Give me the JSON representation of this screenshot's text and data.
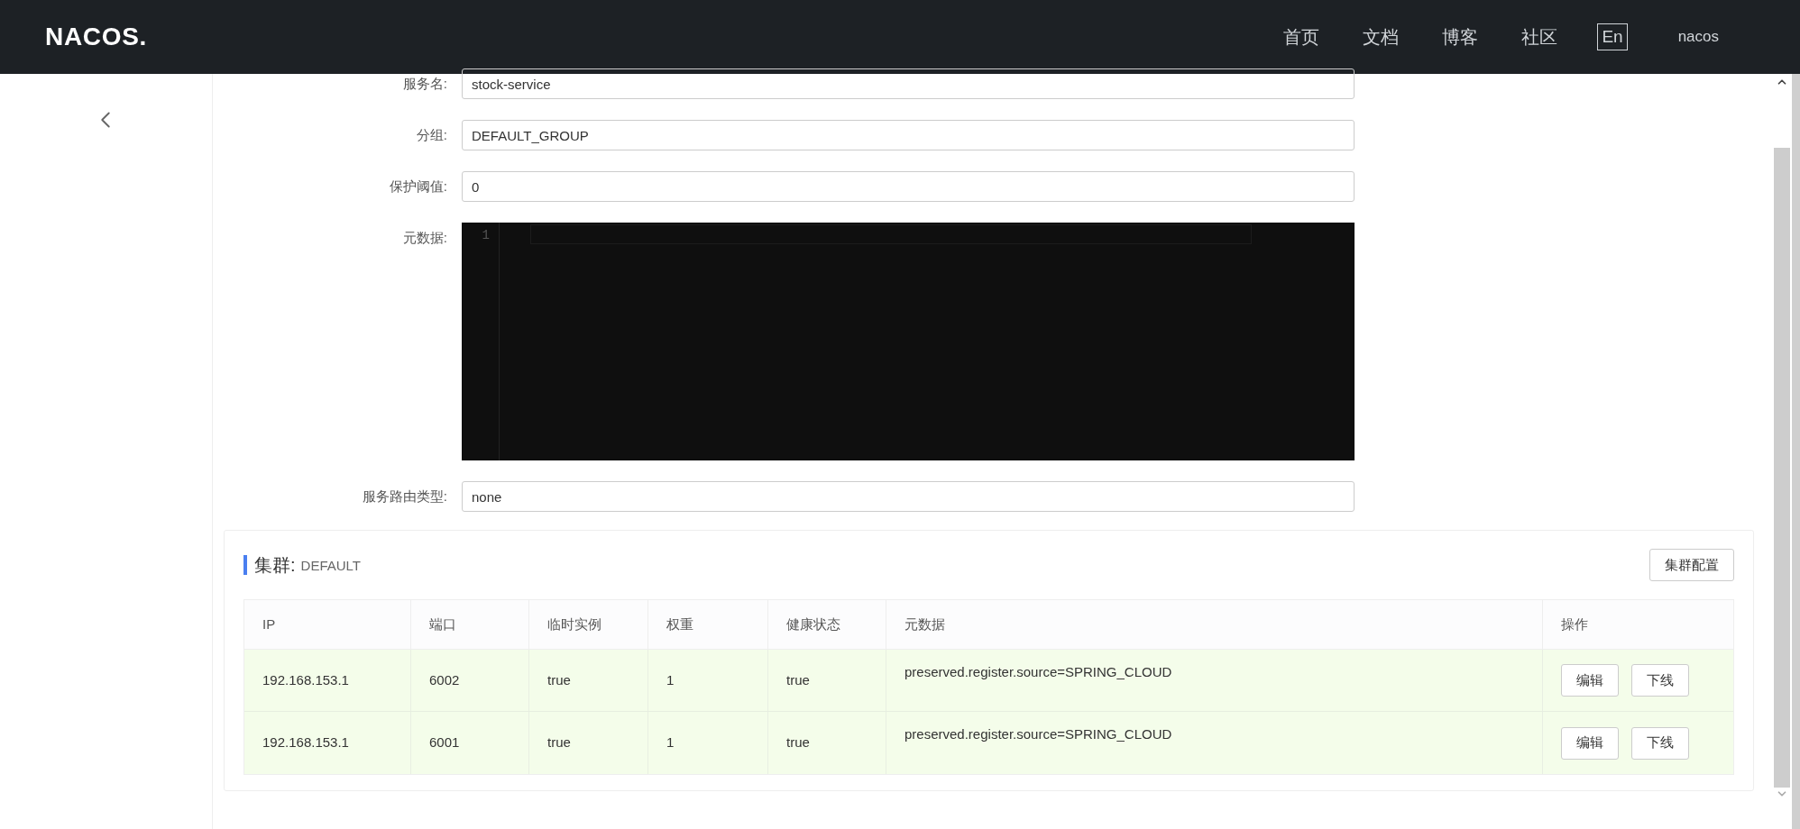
{
  "header": {
    "logo": "NACOS.",
    "nav": [
      "首页",
      "文档",
      "博客",
      "社区"
    ],
    "language": "En",
    "user": "nacos"
  },
  "form": {
    "fields": [
      {
        "kind": "input",
        "label": "服务名:",
        "value": "stock-service"
      },
      {
        "kind": "input",
        "label": "分组:",
        "value": "DEFAULT_GROUP"
      },
      {
        "kind": "input",
        "label": "保护阈值:",
        "value": "0"
      },
      {
        "kind": "editor",
        "label": "元数据:",
        "line_numbers": [
          "1"
        ]
      },
      {
        "kind": "input",
        "label": "服务路由类型:",
        "value": "none"
      }
    ]
  },
  "cluster": {
    "title": "集群:",
    "name": "DEFAULT",
    "config_button": "集群配置",
    "table": {
      "columns": [
        "IP",
        "端口",
        "临时实例",
        "权重",
        "健康状态",
        "元数据",
        "操作"
      ],
      "rows": [
        {
          "cells": [
            "192.168.153.1",
            "6002",
            "true",
            "1",
            "true",
            "preserved.register.source=SPRING_CLOUD"
          ],
          "actions": [
            "编辑",
            "下线"
          ]
        },
        {
          "cells": [
            "192.168.153.1",
            "6001",
            "true",
            "1",
            "true",
            "preserved.register.source=SPRING_CLOUD"
          ],
          "actions": [
            "编辑",
            "下线"
          ]
        }
      ]
    }
  }
}
